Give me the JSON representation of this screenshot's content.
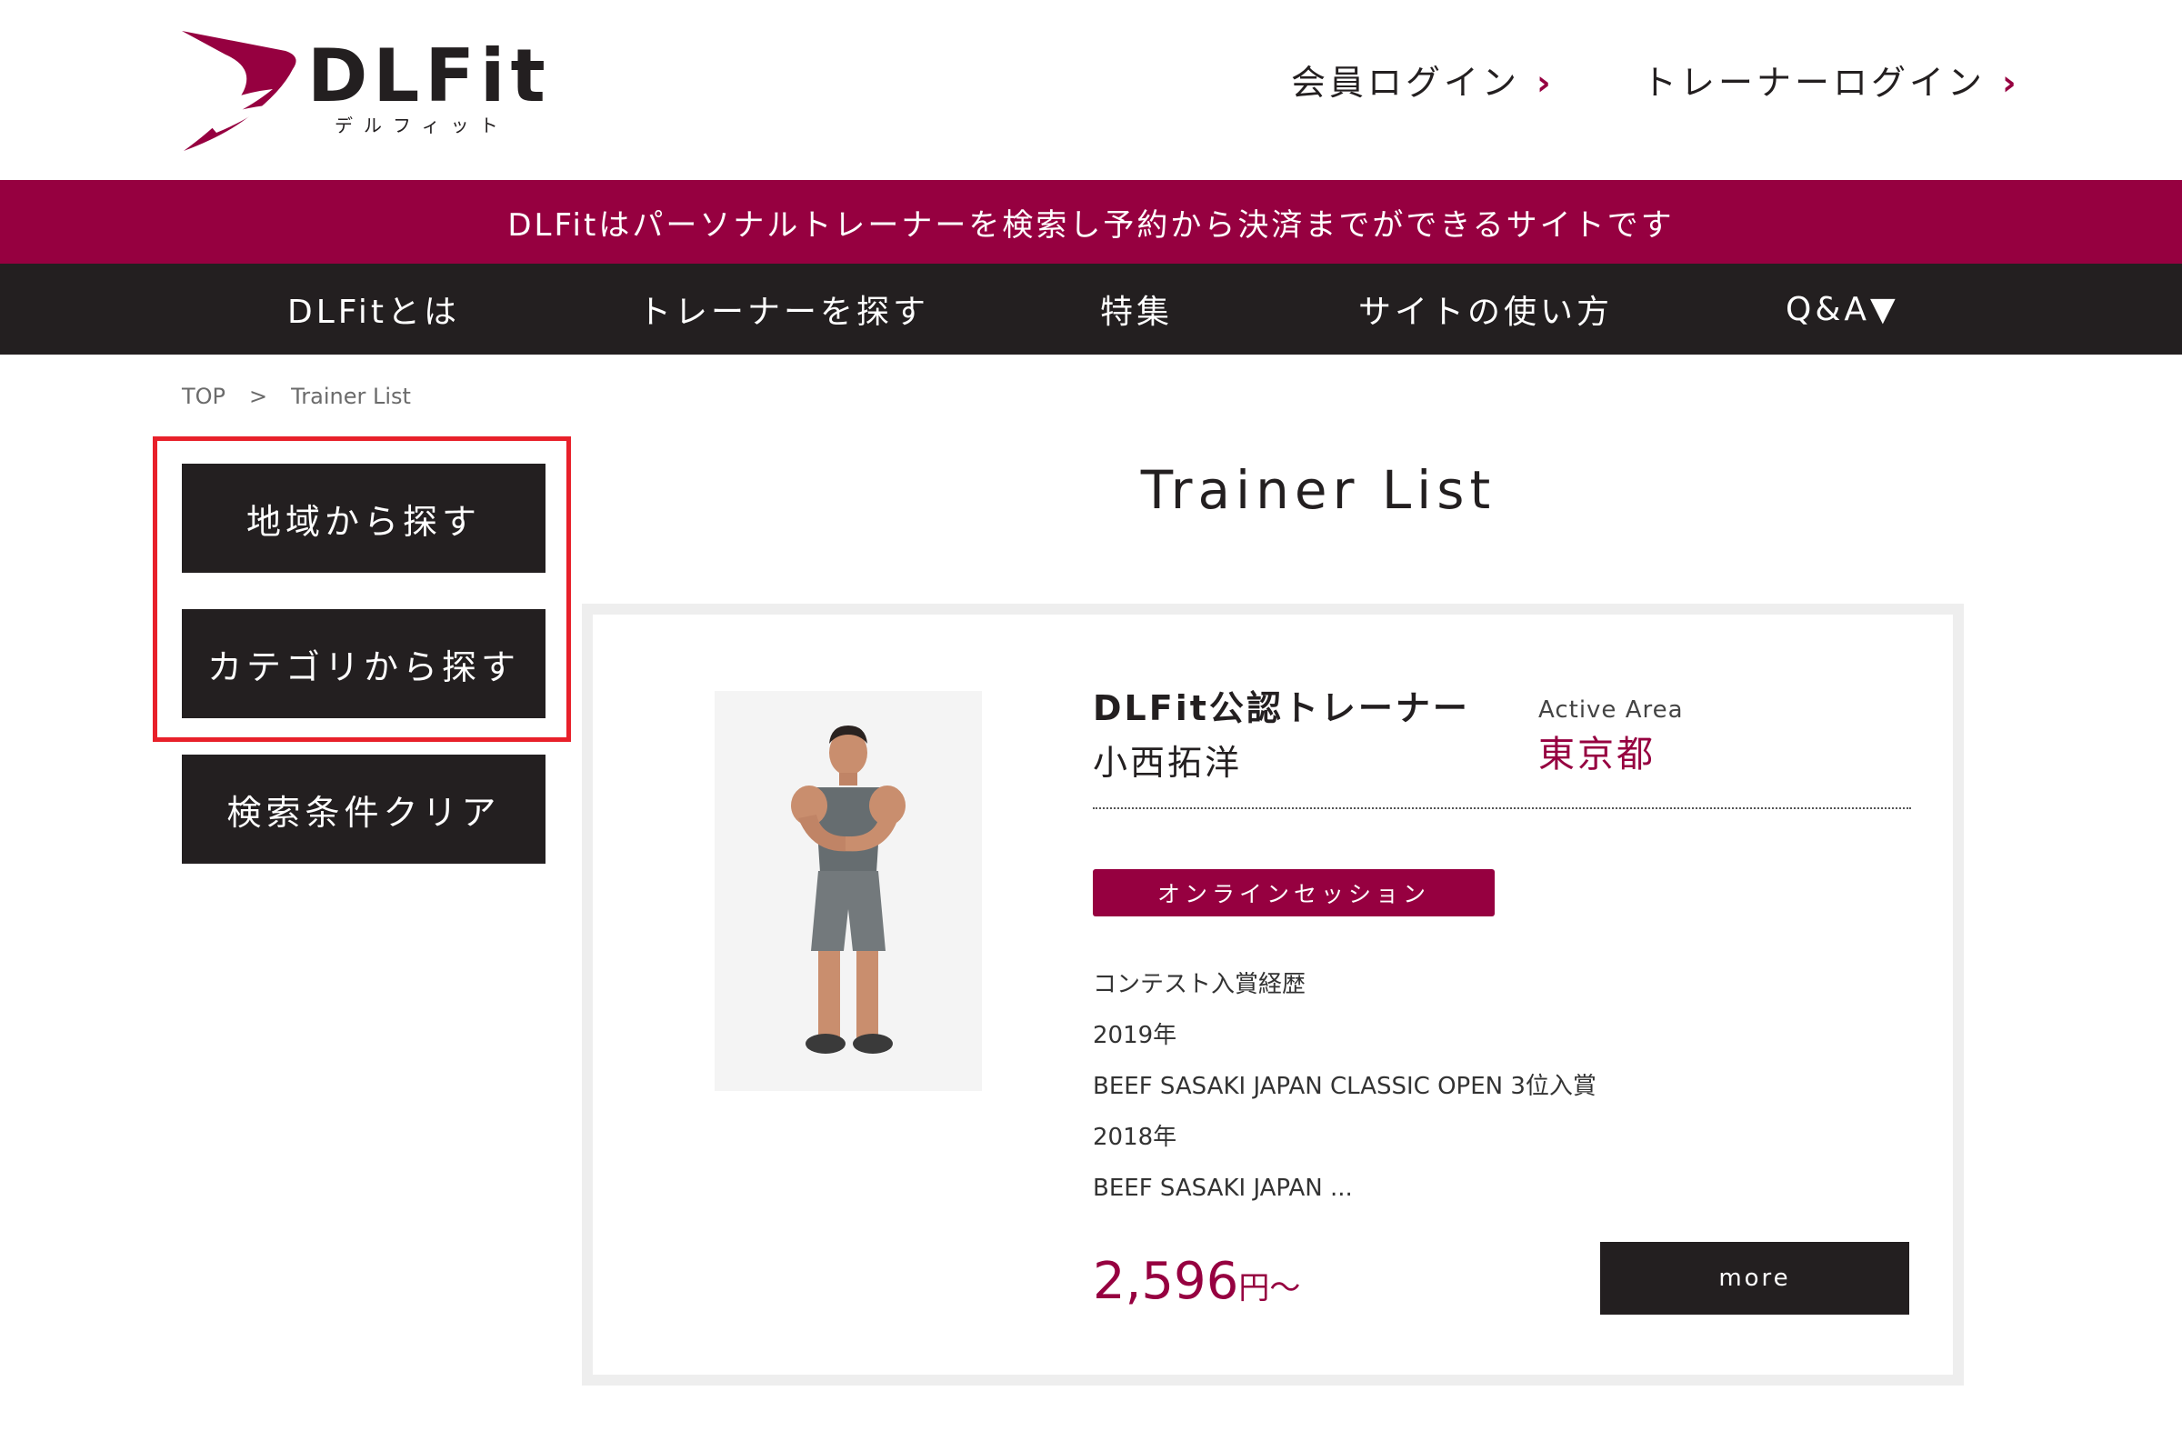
{
  "header": {
    "logo_text": "DLFit",
    "logo_sub": "デルフィット",
    "member_login": "会員ログイン",
    "trainer_login": "トレーナーログイン",
    "chevron": "›"
  },
  "banner": {
    "text": "DLFitはパーソナルトレーナーを検索し予約から決済までができるサイトです"
  },
  "nav": {
    "items": [
      {
        "label": "DLFitとは"
      },
      {
        "label": "トレーナーを探す"
      },
      {
        "label": "特集"
      },
      {
        "label": "サイトの使い方"
      },
      {
        "label": "Q&A▼"
      }
    ]
  },
  "breadcrumb": {
    "top": "TOP",
    "separator": ">",
    "current": "Trainer List"
  },
  "sidebar": {
    "buttons": [
      {
        "label": "地域から探す"
      },
      {
        "label": "カテゴリから探す"
      },
      {
        "label": "検索条件クリア"
      }
    ],
    "highlight_color": "#e8202a"
  },
  "main": {
    "title": "Trainer List",
    "card": {
      "trainer_label": "DLFit公認トレーナー",
      "trainer_name": "小西拓洋",
      "area_label": "Active Area",
      "area_value": "東京都",
      "tag": "オンラインセッション",
      "bio_lines": [
        "コンテスト入賞経歴",
        "2019年",
        "BEEF SASAKI JAPAN CLASSIC OPEN 3位入賞",
        "2018年",
        "BEEF SASAKI JAPAN ..."
      ],
      "price": "2,596",
      "price_suffix": "円〜",
      "more_label": "more"
    }
  },
  "colors": {
    "brand": "#960040",
    "dark": "#231f20",
    "white": "#ffffff"
  },
  "icons": {
    "logo": "dlfit-logo-icon",
    "chevron": "chevron-right-icon",
    "trainer_photo": "trainer-photo"
  }
}
